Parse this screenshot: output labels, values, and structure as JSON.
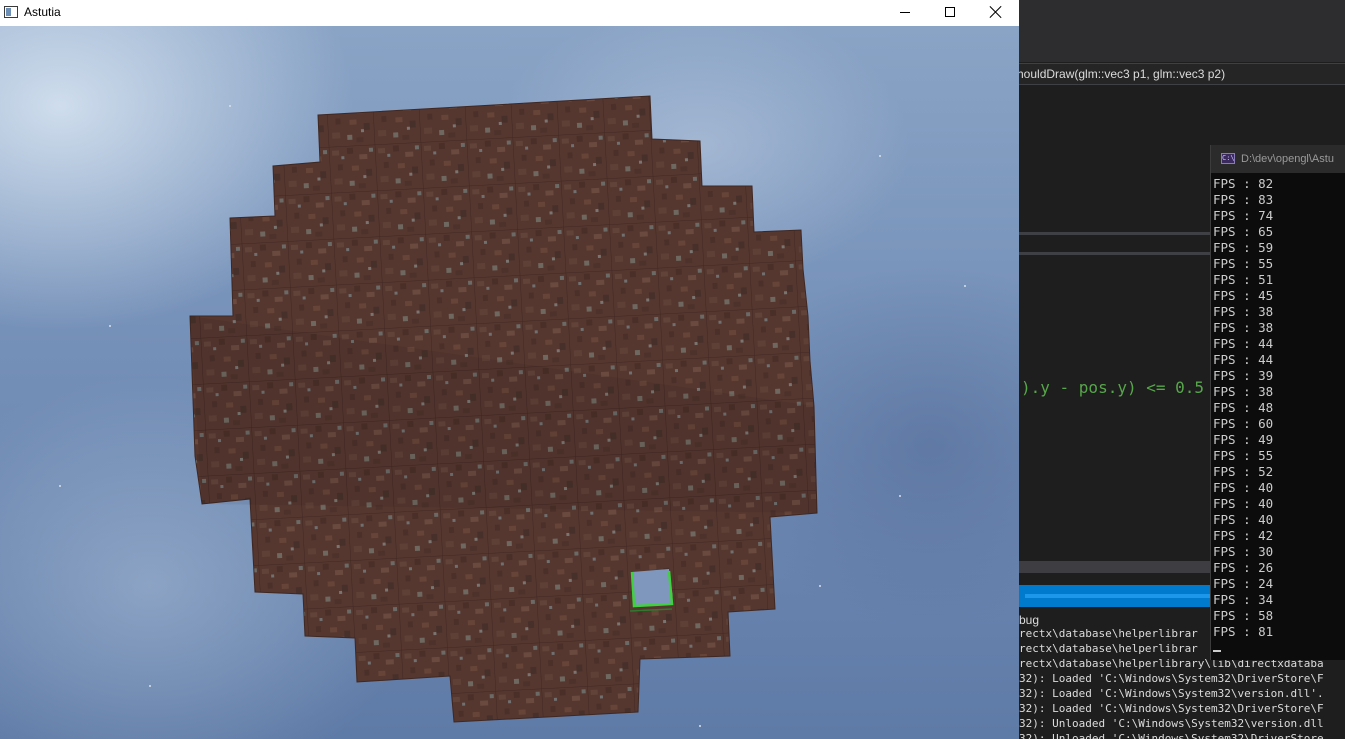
{
  "game_window": {
    "title": "Astutia",
    "buttons": {
      "minimize": "minimize",
      "maximize": "maximize",
      "close": "close"
    }
  },
  "ide": {
    "signature_line": "houldDraw(glm::vec3 p1, glm::vec3 p2)",
    "code_line": ").y - pos.y) <= 0.5",
    "output_header": "bug",
    "output_lines": [
      "rectx\\database\\helperlibrar",
      "rectx\\database\\helperlibrar",
      "rectx\\database\\helperlibrary\\lib\\directxdataba",
      "32): Loaded 'C:\\Windows\\System32\\DriverStore\\F",
      "32): Loaded 'C:\\Windows\\System32\\version.dll'.",
      "32): Loaded 'C:\\Windows\\System32\\DriverStore\\F",
      "32): Unloaded 'C:\\Windows\\System32\\version.dll",
      "32): Unloaded 'C:\\Windows\\System32\\DriverStore"
    ]
  },
  "console": {
    "title": "D:\\dev\\opengl\\Astu",
    "fps_label": "FPS",
    "fps_values": [
      82,
      83,
      74,
      65,
      59,
      55,
      51,
      45,
      38,
      38,
      44,
      44,
      39,
      38,
      48,
      60,
      49,
      55,
      52,
      40,
      40,
      40,
      42,
      30,
      26,
      24,
      34,
      58,
      81
    ]
  },
  "colors": {
    "console_text": "#cccccc",
    "code_green": "#57a64a",
    "progress_blue": "#007acc",
    "dirt": "#55372f",
    "highlight": "#3fd23f"
  }
}
